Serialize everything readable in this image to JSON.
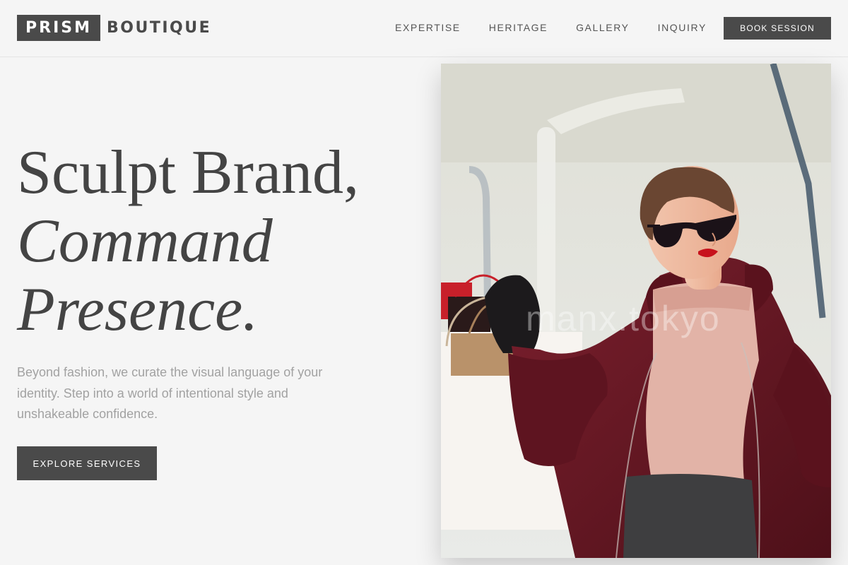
{
  "brand": {
    "mark": "PRISM",
    "word": "BOUTIQUE"
  },
  "nav": {
    "items": [
      {
        "label": "EXPERTISE"
      },
      {
        "label": "HERITAGE"
      },
      {
        "label": "GALLERY"
      },
      {
        "label": "INQUIRY"
      }
    ],
    "cta_label": "BOOK SESSION"
  },
  "hero": {
    "headline": {
      "line1": "Sculpt Brand,",
      "line2": "Command",
      "line3": "Presence."
    },
    "lede": "Beyond fashion, we curate the visual language of your identity. Step into a world of intentional style and unshakeable confidence.",
    "cta_label": "EXPLORE SERVICES",
    "image": {
      "alt": "Woman in burgundy coat and sunglasses holding shopping bags",
      "watermark": "manx.tokyo"
    }
  },
  "colors": {
    "background": "#f5f5f5",
    "button": "#4a4a4a",
    "text": "#444444",
    "muted_text": "#a2a2a2",
    "coat": "#6b1a28"
  }
}
